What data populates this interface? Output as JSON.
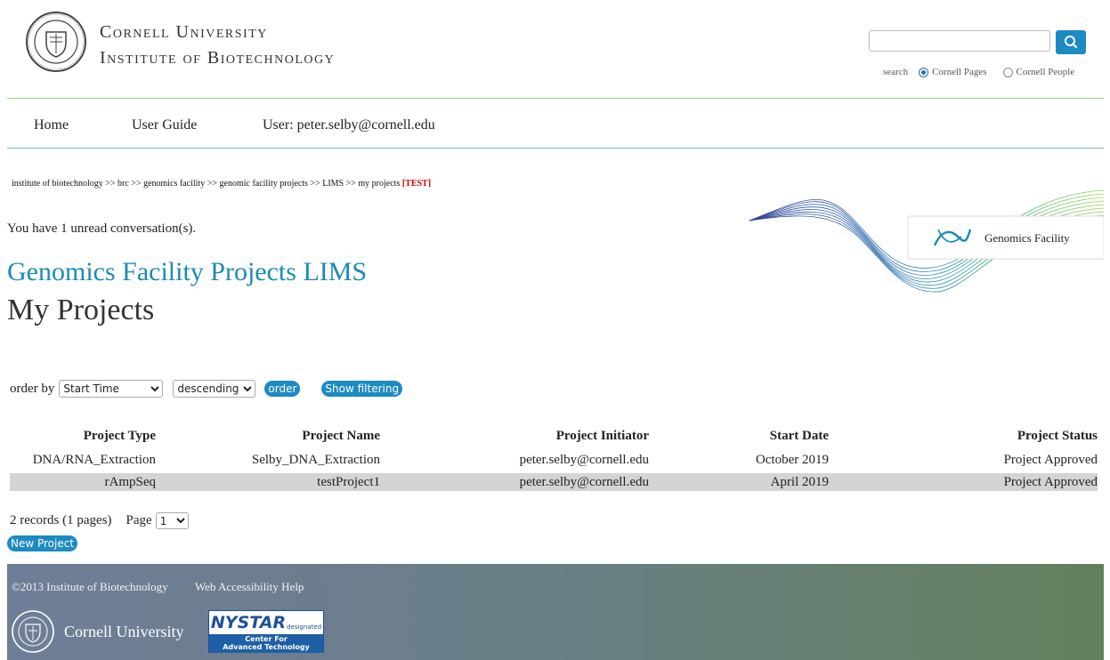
{
  "header": {
    "university": "Cornell University",
    "institute": "Institute of Biotechnology",
    "search": {
      "label": "search",
      "options": [
        "Cornell Pages",
        "Cornell People"
      ],
      "selected": "Cornell Pages",
      "value": ""
    }
  },
  "nav": {
    "items": [
      "Home",
      "User Guide",
      "User: peter.selby@cornell.edu"
    ]
  },
  "breadcrumb": {
    "trail": "institute of biotechnology >> brc >> genomics facility >> genomic facility projects >> LIMS >> my projects",
    "tag": "[TEST]"
  },
  "banner": {
    "label": "Genomics Facility"
  },
  "notice": "You have 1 unread conversation(s).",
  "page": {
    "title": "Genomics Facility Projects LIMS",
    "subtitle": "My Projects"
  },
  "order": {
    "label": "order by",
    "field": "Start Time",
    "direction": "descending",
    "order_button": "order",
    "filter_button": "Show filtering"
  },
  "table": {
    "columns": [
      "Project Type",
      "Project Name",
      "Project Initiator",
      "Start Date",
      "Project Status"
    ],
    "rows": [
      [
        "DNA/RNA_Extraction",
        "Selby_DNA_Extraction",
        "peter.selby@cornell.edu",
        "October 2019",
        "Project Approved"
      ],
      [
        "rAmpSeq",
        "testProject1",
        "peter.selby@cornell.edu",
        "April 2019",
        "Project Approved"
      ]
    ]
  },
  "pagination": {
    "records": "2 records (1 pages)",
    "page_label": "Page",
    "page_value": "1"
  },
  "new_project": "New Project",
  "footer": {
    "copyright": "©2013 Institute of Biotechnology",
    "accessibility": "Web Accessibility Help",
    "cu_name": "Cornell University",
    "nystar_name": "NYSTAR",
    "nystar_note": "designated",
    "nystar_line1": "Center For",
    "nystar_line2": "Advanced Technology"
  },
  "colors": {
    "accent": "#1d8ac4",
    "title": "#1b8ab6",
    "test": "#d10000"
  }
}
